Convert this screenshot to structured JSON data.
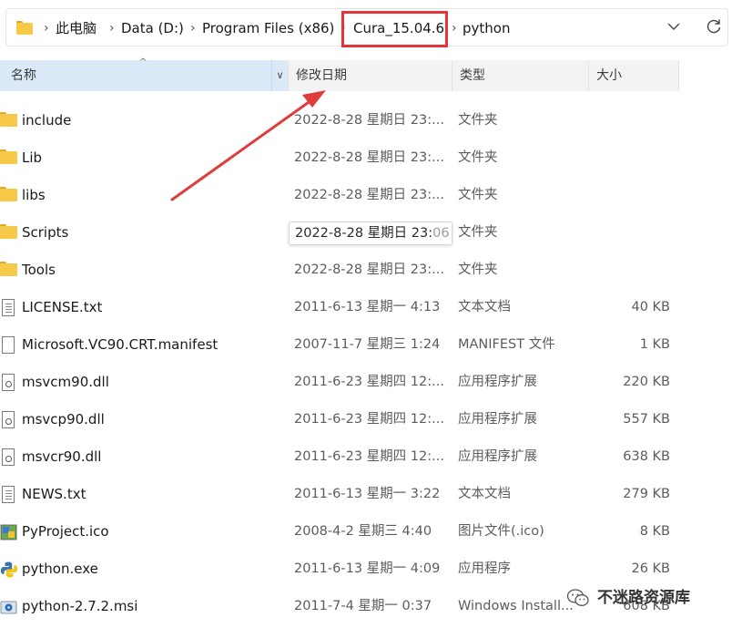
{
  "address": {
    "crumbs": [
      "此电脑",
      "Data (D:)",
      "Program Files (x86)",
      "Cura_15.04.6",
      "python"
    ],
    "separator": "›"
  },
  "header": {
    "name": "名称",
    "date": "修改日期",
    "type": "类型",
    "size": "大小"
  },
  "files": [
    {
      "name": "include",
      "date": "2022-8-28 星期日 23:...",
      "type": "文件夹",
      "size": "",
      "icon": "folder-icon"
    },
    {
      "name": "Lib",
      "date": "2022-8-28 星期日 23:...",
      "type": "文件夹",
      "size": "",
      "icon": "folder-icon"
    },
    {
      "name": "libs",
      "date": "2022-8-28 星期日 23:...",
      "type": "文件夹",
      "size": "",
      "icon": "folder-icon"
    },
    {
      "name": "Scripts",
      "date": "",
      "type": "文件夹",
      "size": "",
      "icon": "folder-icon"
    },
    {
      "name": "Tools",
      "date": "2022-8-28 星期日 23:...",
      "type": "文件夹",
      "size": "",
      "icon": "folder-icon"
    },
    {
      "name": "LICENSE.txt",
      "date": "2011-6-13 星期一 4:13",
      "type": "文本文档",
      "size": "40 KB",
      "icon": "text-file-icon"
    },
    {
      "name": "Microsoft.VC90.CRT.manifest",
      "date": "2007-11-7 星期三 1:24",
      "type": "MANIFEST 文件",
      "size": "1 KB",
      "icon": "file-icon"
    },
    {
      "name": "msvcm90.dll",
      "date": "2011-6-23 星期四 12:...",
      "type": "应用程序扩展",
      "size": "220 KB",
      "icon": "dll-file-icon"
    },
    {
      "name": "msvcp90.dll",
      "date": "2011-6-23 星期四 12:...",
      "type": "应用程序扩展",
      "size": "557 KB",
      "icon": "dll-file-icon"
    },
    {
      "name": "msvcr90.dll",
      "date": "2011-6-23 星期四 12:...",
      "type": "应用程序扩展",
      "size": "638 KB",
      "icon": "dll-file-icon"
    },
    {
      "name": "NEWS.txt",
      "date": "2011-6-13 星期一 3:22",
      "type": "文本文档",
      "size": "279 KB",
      "icon": "text-file-icon"
    },
    {
      "name": "PyProject.ico",
      "date": "2008-4-2 星期三 4:40",
      "type": "图片文件(.ico)",
      "size": "8 KB",
      "icon": "image-file-icon"
    },
    {
      "name": "python.exe",
      "date": "2011-6-13 星期一 4:09",
      "type": "应用程序",
      "size": "26 KB",
      "icon": "python-exe-icon"
    },
    {
      "name": "python-2.7.2.msi",
      "date": "2011-7-4 星期一 0:37",
      "type": "Windows Install...",
      "size": "608 KB",
      "icon": "installer-icon"
    }
  ],
  "tooltip": {
    "text": "2022-8-28 星期日 23:",
    "tail": "06"
  },
  "watermark": {
    "text": "不迷路资源库"
  },
  "colors": {
    "highlight_box": "#e8333a",
    "annotation_arrow": "#e03c3c",
    "selected_header": "#dbe9f8",
    "folder": "#f7c948"
  }
}
